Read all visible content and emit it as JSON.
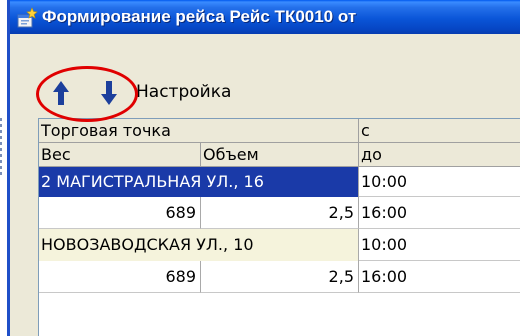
{
  "window": {
    "title": "Формирование рейса Рейс ТК0010 от"
  },
  "toolbar": {
    "up_icon": "arrow-up-icon",
    "down_icon": "arrow-down-icon",
    "settings_label": "Настройка"
  },
  "grid": {
    "header_row1": {
      "point": "Торговая точка",
      "from": "с"
    },
    "header_row2": {
      "weight": "Вес",
      "volume": "Объем",
      "to": "до"
    },
    "records": [
      {
        "point": "2 МАГИСТРАЛЬНАЯ УЛ., 16",
        "from": "10:00",
        "weight": "689",
        "volume": "2,5",
        "to": "16:00",
        "selected": true
      },
      {
        "point": "НОВОЗАВОДСКАЯ УЛ., 10",
        "from": "10:00",
        "weight": "689",
        "volume": "2,5",
        "to": "16:00",
        "selected": false
      }
    ]
  },
  "colors": {
    "titlebar": "#0a55d8",
    "selection": "#1a3aa8",
    "annotation": "#e00000",
    "arrow": "#1c3f9c"
  }
}
